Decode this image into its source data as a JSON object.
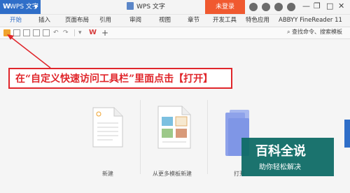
{
  "app": {
    "logo": "W",
    "name": "WPS 文字",
    "menu_arrow": "▼"
  },
  "doc_title": "WPS 文字",
  "login": "未登录",
  "window_controls": {
    "minimize": "—",
    "restore": "❐",
    "close": "✕"
  },
  "tabs": [
    "开始",
    "插入",
    "页面布局",
    "引用",
    "审阅",
    "视图",
    "章节",
    "开发工具",
    "特色应用",
    "ABBYY FineReader 11"
  ],
  "active_tab": 0,
  "qat": {
    "search_label": "查找命令、搜索模板"
  },
  "annotation": "在“自定义快速访问工具栏”里面点击【打开】",
  "cards": [
    {
      "label": "新建"
    },
    {
      "label": "从更多模板新建"
    },
    {
      "label": "打开"
    }
  ],
  "watermark": {
    "title": "百科全说",
    "subtitle": "助你轻松解决"
  },
  "colors": {
    "accent": "#2f6ec8",
    "login_bg": "#f0592f",
    "annotation": "#e0262b",
    "watermark": "#0f6c66"
  }
}
